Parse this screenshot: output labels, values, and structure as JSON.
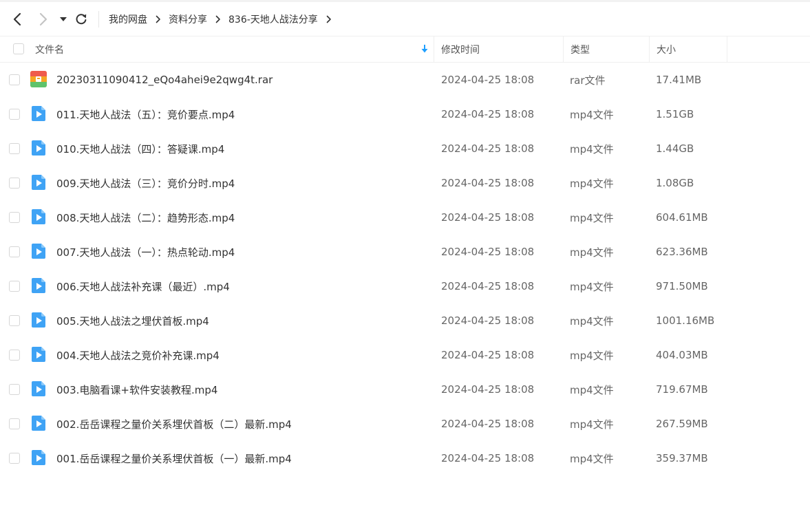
{
  "toolbar": {
    "back_icon": "chevron-left-icon",
    "forward_icon": "chevron-right-icon",
    "history_icon": "caret-down-icon",
    "refresh_icon": "refresh-icon"
  },
  "breadcrumb": {
    "items": [
      "我的网盘",
      "资料分享",
      "836-天地人战法分享"
    ],
    "separator": ">"
  },
  "table": {
    "headers": {
      "name": "文件名",
      "modified": "修改时间",
      "type": "类型",
      "size": "大小"
    },
    "sort_icon": "sort-down-arrow-icon",
    "rows": [
      {
        "name": "20230311090412_eQo4ahei9e2qwg4t.rar",
        "date": "2024-04-25 18:08",
        "type": "rar文件",
        "size": "17.41MB",
        "icon": "archive-file-icon"
      },
      {
        "name": "011.天地人战法（五）：竞价要点.mp4",
        "date": "2024-04-25 18:08",
        "type": "mp4文件",
        "size": "1.51GB",
        "icon": "video-file-icon"
      },
      {
        "name": "010.天地人战法（四）：答疑课.mp4",
        "date": "2024-04-25 18:08",
        "type": "mp4文件",
        "size": "1.44GB",
        "icon": "video-file-icon"
      },
      {
        "name": "009.天地人战法（三）：竞价分时.mp4",
        "date": "2024-04-25 18:08",
        "type": "mp4文件",
        "size": "1.08GB",
        "icon": "video-file-icon"
      },
      {
        "name": "008.天地人战法（二）：趋势形态.mp4",
        "date": "2024-04-25 18:08",
        "type": "mp4文件",
        "size": "604.61MB",
        "icon": "video-file-icon"
      },
      {
        "name": "007.天地人战法（一）：热点轮动.mp4",
        "date": "2024-04-25 18:08",
        "type": "mp4文件",
        "size": "623.36MB",
        "icon": "video-file-icon"
      },
      {
        "name": "006.天地人战法补充课（最近）.mp4",
        "date": "2024-04-25 18:08",
        "type": "mp4文件",
        "size": "971.50MB",
        "icon": "video-file-icon"
      },
      {
        "name": "005.天地人战法之埋伏首板.mp4",
        "date": "2024-04-25 18:08",
        "type": "mp4文件",
        "size": "1001.16MB",
        "icon": "video-file-icon"
      },
      {
        "name": "004.天地人战法之竞价补充课.mp4",
        "date": "2024-04-25 18:08",
        "type": "mp4文件",
        "size": "404.03MB",
        "icon": "video-file-icon"
      },
      {
        "name": "003.电脑看课+软件安装教程.mp4",
        "date": "2024-04-25 18:08",
        "type": "mp4文件",
        "size": "719.67MB",
        "icon": "video-file-icon"
      },
      {
        "name": "002.岳岳课程之量价关系埋伏首板（二）最新.mp4",
        "date": "2024-04-25 18:08",
        "type": "mp4文件",
        "size": "267.59MB",
        "icon": "video-file-icon"
      },
      {
        "name": "001.岳岳课程之量价关系埋伏首板（一）最新.mp4",
        "date": "2024-04-25 18:08",
        "type": "mp4文件",
        "size": "359.37MB",
        "icon": "video-file-icon"
      }
    ]
  },
  "colors": {
    "accent": "#1e9fff",
    "video_icon": "#3fa3f5",
    "text": "#333333",
    "muted_text": "#666666",
    "border": "#efefef"
  }
}
